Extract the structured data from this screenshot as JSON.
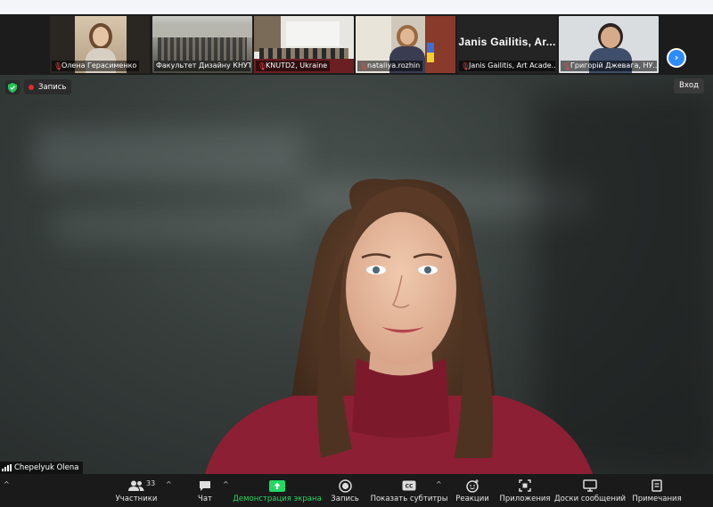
{
  "participants_strip": [
    {
      "name": "Олена Герасименко",
      "muted": true,
      "scene": "portrait"
    },
    {
      "name": "Факультет Дизайну КНУТД",
      "muted": false,
      "scene": "hall"
    },
    {
      "name": "KNUTD2, Ukraine",
      "muted": true,
      "scene": "stage"
    },
    {
      "name": "nataliya.rozhin",
      "muted": true,
      "scene": "office"
    },
    {
      "name": "Janis Gailitis, Art Acade...",
      "muted": true,
      "scene": "name-tile",
      "tile_title": "Janis  Gailitis,  Ar..."
    },
    {
      "name": "Григорій Джевага, НУ...",
      "muted": true,
      "scene": "man"
    }
  ],
  "main_video": {
    "speaker_name": "Chepelyuk Olena",
    "recording_label": "Запись",
    "view_button": "Вход"
  },
  "toolbar": {
    "participants_count": "33",
    "items": [
      {
        "id": "participants",
        "label": "Участники"
      },
      {
        "id": "chat",
        "label": "Чат"
      },
      {
        "id": "share",
        "label": "Демонстрация экрана"
      },
      {
        "id": "record",
        "label": "Запись"
      },
      {
        "id": "captions",
        "label": "Показать субтитры"
      },
      {
        "id": "reactions",
        "label": "Реакции"
      },
      {
        "id": "apps",
        "label": "Приложения"
      },
      {
        "id": "whiteboards",
        "label": "Доски сообщений"
      },
      {
        "id": "notes",
        "label": "Примечания"
      }
    ]
  },
  "colors": {
    "accent_blue": "#2d8cff",
    "share_green": "#23d962",
    "record_red": "#e02828",
    "sweater_red": "#8c1f33"
  }
}
